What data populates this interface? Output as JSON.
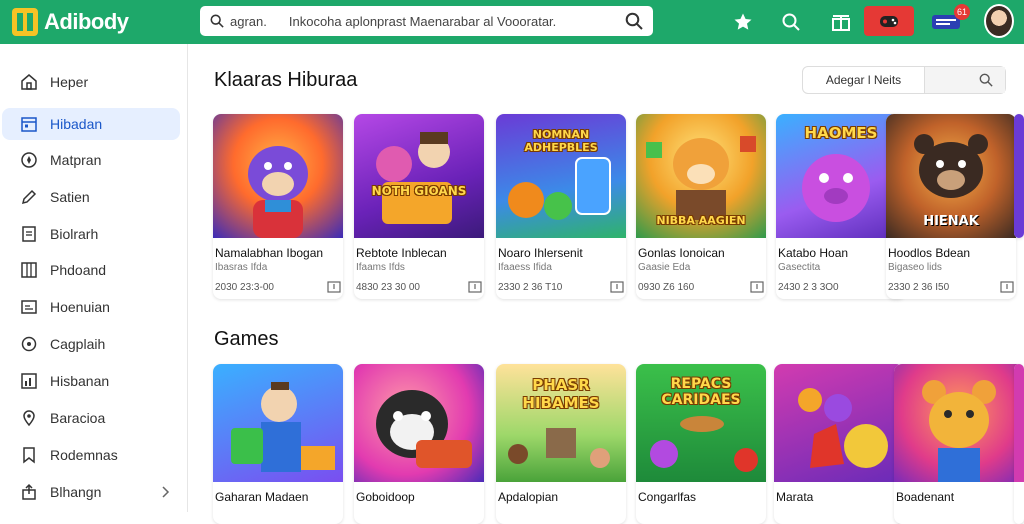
{
  "app": {
    "name": "Adibody"
  },
  "search": {
    "prefix": "agran.",
    "query": "Inkocoha aplonprast Maenarabar al Voooratar."
  },
  "topbar": {
    "notification_count": "61",
    "colors": {
      "bar": "#1ea86a",
      "button": "#e53935"
    }
  },
  "sidebar": {
    "items": [
      {
        "label": "Heper",
        "icon": "home-icon"
      },
      {
        "label": "Hibadan",
        "icon": "calendar-icon",
        "active": true
      },
      {
        "label": "Matpran",
        "icon": "compass-icon"
      },
      {
        "label": "Satien",
        "icon": "pencil-icon"
      },
      {
        "label": "Biolrarh",
        "icon": "document-icon"
      },
      {
        "label": "Phdoand",
        "icon": "grid-icon"
      },
      {
        "label": "Hoenuian",
        "icon": "list-icon"
      },
      {
        "label": "Cagplaih",
        "icon": "refresh-icon"
      },
      {
        "label": "Hisbanan",
        "icon": "chart-icon"
      },
      {
        "label": "Baracioa",
        "icon": "location-icon"
      },
      {
        "label": "Rodemnas",
        "icon": "bookmark-icon"
      },
      {
        "label": "Blhangn",
        "icon": "share-icon"
      }
    ]
  },
  "section1": {
    "title": "Klaaras Hiburaa",
    "filter_label": "Adegar l Neits",
    "cards": [
      {
        "name": "Namalabhan Ibogan",
        "sub": "Ibasras Ifda",
        "meta": "2030 23:3-00",
        "art": ""
      },
      {
        "name": "Rebtote Inblecan",
        "sub": "Ifaams Ifds",
        "meta": "4830 23 30 00",
        "art": "NOTH GIOANS"
      },
      {
        "name": "Noaro Ihlersenit",
        "sub": "Ifaaess Ifida",
        "meta": "2330 2 36 T10",
        "art": "NOMNAN ADHEPBLES"
      },
      {
        "name": "Gonlas Ionoican",
        "sub": "Gaasie Eda",
        "meta": "0930 Z6 160",
        "art": "NIBBA AAGIEN"
      },
      {
        "name": "Katabo Hoan",
        "sub": "Gasectita",
        "meta": "2430 2 3 3O0",
        "art": "HAOMES"
      },
      {
        "name": "Hoodlos Bdean",
        "sub": "Bigaseo lids",
        "meta": "2330 2 36 I50",
        "art": "HIENAK"
      }
    ]
  },
  "section2": {
    "title": "Games",
    "cards": [
      {
        "name": "Gaharan Madaen",
        "art": ""
      },
      {
        "name": "Goboidoop",
        "art": ""
      },
      {
        "name": "Apdalopian",
        "art": "PHASR HIBAMES"
      },
      {
        "name": "Congarlfas",
        "art": "REPACS CARIDAES"
      },
      {
        "name": "Marata",
        "art": ""
      },
      {
        "name": "Boadenant",
        "art": ""
      }
    ]
  }
}
